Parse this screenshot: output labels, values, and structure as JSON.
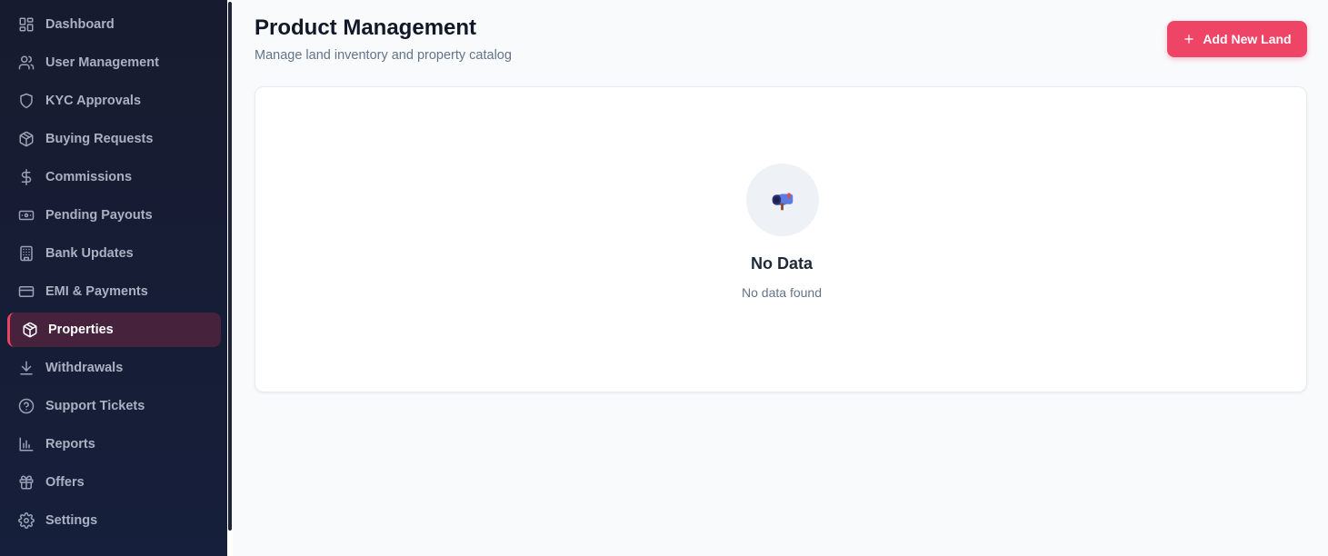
{
  "sidebar": {
    "items": [
      {
        "label": "Dashboard",
        "icon": "dashboard-grid-icon"
      },
      {
        "label": "User Management",
        "icon": "users-icon"
      },
      {
        "label": "KYC Approvals",
        "icon": "shield-icon"
      },
      {
        "label": "Buying Requests",
        "icon": "package-icon"
      },
      {
        "label": "Commissions",
        "icon": "dollar-icon"
      },
      {
        "label": "Pending Payouts",
        "icon": "banknote-icon"
      },
      {
        "label": "Bank Updates",
        "icon": "building-icon"
      },
      {
        "label": "EMI & Payments",
        "icon": "credit-card-icon"
      },
      {
        "label": "Properties",
        "icon": "package-icon",
        "active": true
      },
      {
        "label": "Withdrawals",
        "icon": "download-icon"
      },
      {
        "label": "Support Tickets",
        "icon": "help-circle-icon"
      },
      {
        "label": "Reports",
        "icon": "bar-chart-icon"
      },
      {
        "label": "Offers",
        "icon": "gift-icon"
      },
      {
        "label": "Settings",
        "icon": "gear-icon"
      }
    ]
  },
  "header": {
    "title": "Product Management",
    "subtitle": "Manage land inventory and property catalog",
    "add_button_label": "Add New Land"
  },
  "empty_state": {
    "icon": "mailbox-icon",
    "title": "No Data",
    "description": "No data found"
  },
  "colors": {
    "accent": "#ee4567",
    "sidebar_bg": "#171b2f",
    "active_bg": "#46223d"
  }
}
